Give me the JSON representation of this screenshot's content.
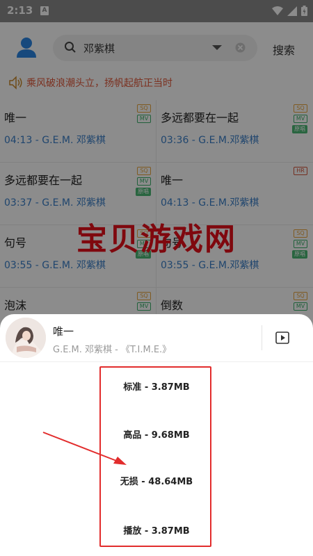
{
  "status_bar": {
    "time": "2:13",
    "notif_letter": "A"
  },
  "header": {
    "search_query": "邓紫棋",
    "search_button": "搜索"
  },
  "notice": {
    "text": "乘风破浪潮头立，扬帆起航正当时"
  },
  "songs": [
    {
      "title": "唯一",
      "meta": "04:13 - G.E.M. 邓紫棋",
      "badges": [
        "SQ",
        "MV"
      ]
    },
    {
      "title": "多远都要在一起",
      "meta": "03:36 - G.E.M.邓紫棋",
      "badges": [
        "SQ",
        "MV",
        "原唱"
      ]
    },
    {
      "title": "多远都要在一起",
      "meta": "03:37 - G.E.M. 邓紫棋",
      "badges": [
        "SQ",
        "MV",
        "原唱"
      ]
    },
    {
      "title": "唯一",
      "meta": "04:13 - G.E.M.邓紫棋",
      "badges": [
        "HR"
      ]
    },
    {
      "title": "句号",
      "meta": "03:55 - G.E.M. 邓紫棋",
      "badges": [
        "SQ",
        "MV",
        "原唱"
      ]
    },
    {
      "title": "句号",
      "meta": "03:55 - G.E.M.邓紫棋",
      "badges": [
        "SQ",
        "MV",
        "原唱"
      ]
    },
    {
      "title": "泡沫",
      "meta": "",
      "badges": [
        "SQ",
        "MV"
      ]
    },
    {
      "title": "倒数",
      "meta": "",
      "badges": [
        "SQ",
        "MV"
      ]
    }
  ],
  "watermark": "宝贝游戏网",
  "sheet": {
    "title": "唯一",
    "subtitle": "G.E.M. 邓紫棋 - 《T.I.M.E.》",
    "options": [
      "标准 - 3.87MB",
      "高品 - 9.68MB",
      "无损 - 48.64MB",
      "播放 - 3.87MB"
    ]
  },
  "colors": {
    "accent": "#3a7fc8",
    "notice": "#e0583a",
    "highlight": "#e22c2c"
  }
}
